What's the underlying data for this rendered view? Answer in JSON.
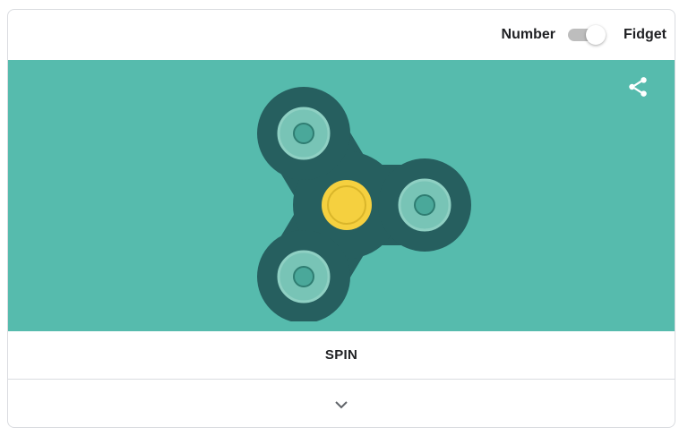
{
  "header": {
    "left_label": "Number",
    "right_label": "Fidget",
    "toggle_state": "fidget"
  },
  "stage": {
    "background_color": "#56bbad",
    "spinner_body_color": "#265f5f",
    "bearing_color": "#f5d03f",
    "weight_color": "#78c4b6",
    "share_icon": "share-icon"
  },
  "actions": {
    "spin_label": "SPIN",
    "expand_icon": "chevron-down-icon"
  }
}
